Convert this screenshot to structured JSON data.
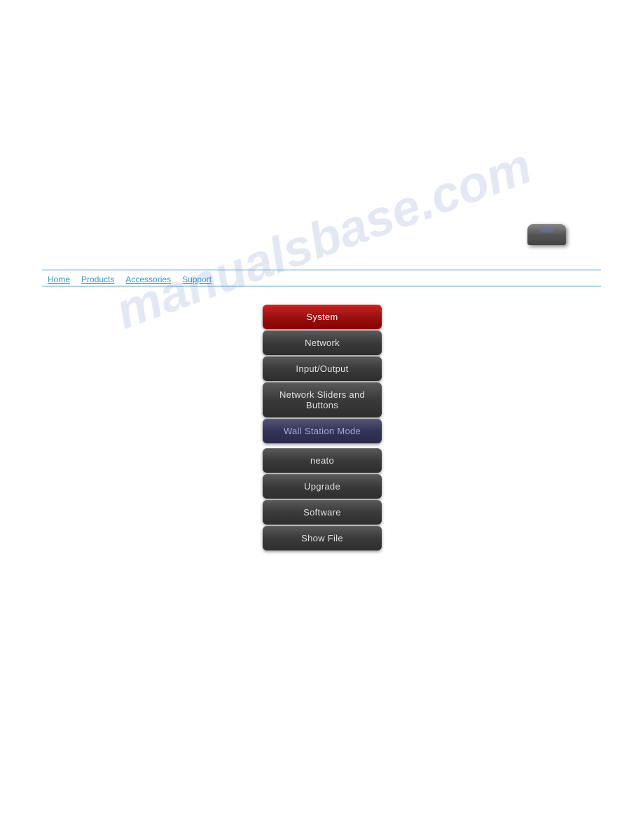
{
  "watermark": {
    "text": "manualsbase.com"
  },
  "nav": {
    "links": [
      {
        "label": "Home",
        "id": "home-link"
      },
      {
        "label": "Products",
        "id": "products-link"
      },
      {
        "label": "Accessories",
        "id": "accessories-link"
      },
      {
        "label": "Support",
        "id": "support-link"
      }
    ]
  },
  "menu": {
    "items": [
      {
        "label": "System",
        "id": "system-btn",
        "state": "active"
      },
      {
        "label": "Network",
        "id": "network-btn",
        "state": "normal"
      },
      {
        "label": "Input/Output",
        "id": "inputoutput-btn",
        "state": "normal"
      },
      {
        "label": "Network Sliders and Buttons",
        "id": "network-sliders-btn",
        "state": "normal"
      },
      {
        "label": "Wall Station Mode",
        "id": "wall-station-btn",
        "state": "selected"
      },
      {
        "label": "neato",
        "id": "neato-btn",
        "state": "normal"
      },
      {
        "label": "Upgrade",
        "id": "upgrade-btn",
        "state": "normal"
      },
      {
        "label": "Software",
        "id": "software-btn",
        "state": "normal"
      },
      {
        "label": "Show File",
        "id": "show-file-btn",
        "state": "normal"
      }
    ]
  }
}
